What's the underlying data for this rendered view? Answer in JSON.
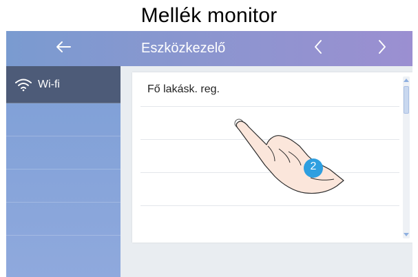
{
  "caption": "Mellék monitor",
  "header": {
    "back_icon": "arrow-left-icon",
    "title": "Eszközkezelő",
    "prev_icon": "chevron-left-icon",
    "next_icon": "chevron-right-icon"
  },
  "sidebar": {
    "items": [
      {
        "label": "Wi-fi",
        "icon": "wifi-icon",
        "active": true
      }
    ]
  },
  "list": {
    "items": [
      {
        "label": "Fő lakásk. reg."
      },
      {
        "label": ""
      },
      {
        "label": ""
      },
      {
        "label": ""
      }
    ]
  },
  "overlay": {
    "step_number": "2",
    "icon": "pointing-hand-icon"
  },
  "colors": {
    "header_start": "#7a9bd0",
    "header_end": "#9b8fd1",
    "sidebar": "#8fa9dd",
    "sidebar_active": "#4d5b78",
    "step_badge": "#2e9fe0"
  }
}
